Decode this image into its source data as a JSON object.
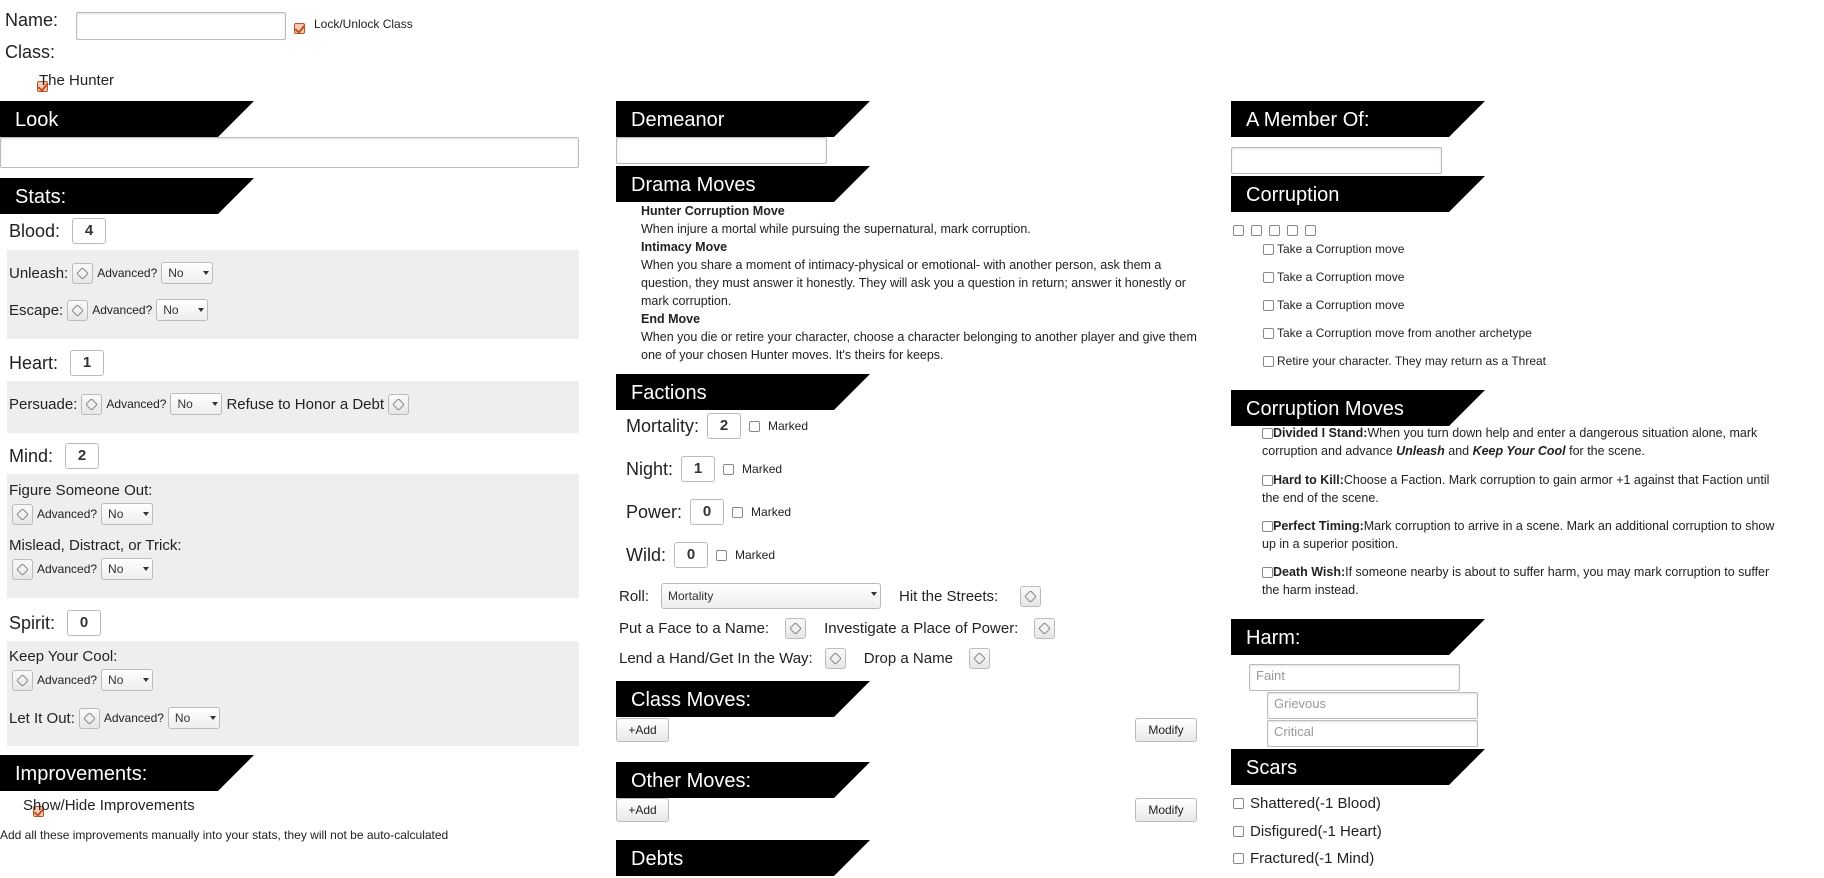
{
  "top": {
    "name_label": "Name:",
    "name_value": "",
    "lock_label": "Lock/Unlock Class",
    "class_label": "Class:",
    "class_option": "The Hunter"
  },
  "left": {
    "look_title": "Look",
    "stats_title": "Stats:",
    "blood": {
      "label": "Blood:",
      "value": "4"
    },
    "unleash": {
      "label": "Unleash:",
      "advanced": "Advanced?",
      "select": "No"
    },
    "escape": {
      "label": "Escape:",
      "advanced": "Advanced?",
      "select": "No"
    },
    "heart": {
      "label": "Heart:",
      "value": "1"
    },
    "persuade": {
      "label": "Persuade:",
      "advanced": "Advanced?",
      "select": "No",
      "extra": "Refuse to Honor a Debt"
    },
    "mind": {
      "label": "Mind:",
      "value": "2"
    },
    "figure": {
      "label": "Figure Someone Out:",
      "advanced": "Advanced?",
      "select": "No"
    },
    "mislead": {
      "label": "Mislead, Distract, or Trick:",
      "advanced": "Advanced?",
      "select": "No"
    },
    "spirit": {
      "label": "Spirit:",
      "value": "0"
    },
    "keepcool": {
      "label": "Keep Your Cool:",
      "advanced": "Advanced?",
      "select": "No"
    },
    "letout": {
      "label": "Let It Out:",
      "advanced": "Advanced?",
      "select": "No"
    },
    "improvements_title": "Improvements:",
    "show_hide": "Show/Hide Improvements",
    "improvements_note": "Add all these improvements manually into your stats, they will not be auto-calculated"
  },
  "middle": {
    "demeanor_title": "Demeanor",
    "drama_title": "Drama Moves",
    "drama_moves": [
      {
        "name": "Hunter Corruption Move",
        "text": "When injure a mortal while pursuing the supernatural, mark corruption."
      },
      {
        "name": "Intimacy Move",
        "text": "When you share a moment of intimacy-physical or emotional- with another person, ask them a question, they must answer it honestly. They will ask you a question in return; answer it honestly or mark corruption."
      },
      {
        "name": "End Move",
        "text": "When you die or retire your character, choose a character belonging to another player and give them one of your chosen Hunter moves. It's theirs for keeps."
      }
    ],
    "factions_title": "Factions",
    "factions": [
      {
        "label": "Mortality:",
        "value": "2",
        "marked": "Marked"
      },
      {
        "label": "Night:",
        "value": "1",
        "marked": "Marked"
      },
      {
        "label": "Power:",
        "value": "0",
        "marked": "Marked"
      },
      {
        "label": "Wild:",
        "value": "0",
        "marked": "Marked"
      }
    ],
    "roll_label": "Roll:",
    "roll_select": "Mortality",
    "hit_streets": "Hit the Streets:",
    "face_name": "Put a Face to a Name:",
    "investigate": "Investigate a Place of Power:",
    "lend_hand": "Lend a Hand/Get In the Way:",
    "drop_name": "Drop a Name",
    "class_moves_title": "Class Moves:",
    "add_label": "+Add",
    "modify_label": "Modify",
    "other_moves_title": "Other Moves:",
    "debts_title": "Debts"
  },
  "right": {
    "member_title": "A Member Of:",
    "corruption_title": "Corruption",
    "corruption_items": [
      "Take a Corruption move",
      "Take a Corruption move",
      "Take a Corruption move",
      "Take a Corruption move from another archetype",
      "Retire your character. They may return as a Threat"
    ],
    "corruption_moves_title": "Corruption Moves",
    "corruption_moves": [
      {
        "name": "Divided I Stand:",
        "text1": "When you turn down help and enter a dangerous situation alone, mark",
        "text2a": "corruption and advance ",
        "em1": "Unleash",
        "and": " and ",
        "em2": "Keep Your Cool",
        "text2b": " for the scene."
      },
      {
        "name": "Hard to Kill:",
        "text1": "Choose a Faction. Mark corruption to gain armor +1 against that Faction until",
        "text2": "the end of the scene."
      },
      {
        "name": "Perfect Timing:",
        "text1": "Mark corruption to arrive in a scene. Mark an additional corruption to show",
        "text2": "up in a superior position."
      },
      {
        "name": "Death Wish:",
        "text1": "If someone nearby is about to suffer harm, you may mark corruption to suffer",
        "text2": "the harm instead."
      }
    ],
    "harm_title": "Harm:",
    "harm": {
      "faint": "Faint",
      "grievous": "Grievous",
      "critical": "Critical"
    },
    "scars_title": "Scars",
    "scars": [
      "Shattered(-1 Blood)",
      "Disfigured(-1 Heart)",
      "Fractured(-1 Mind)"
    ]
  }
}
